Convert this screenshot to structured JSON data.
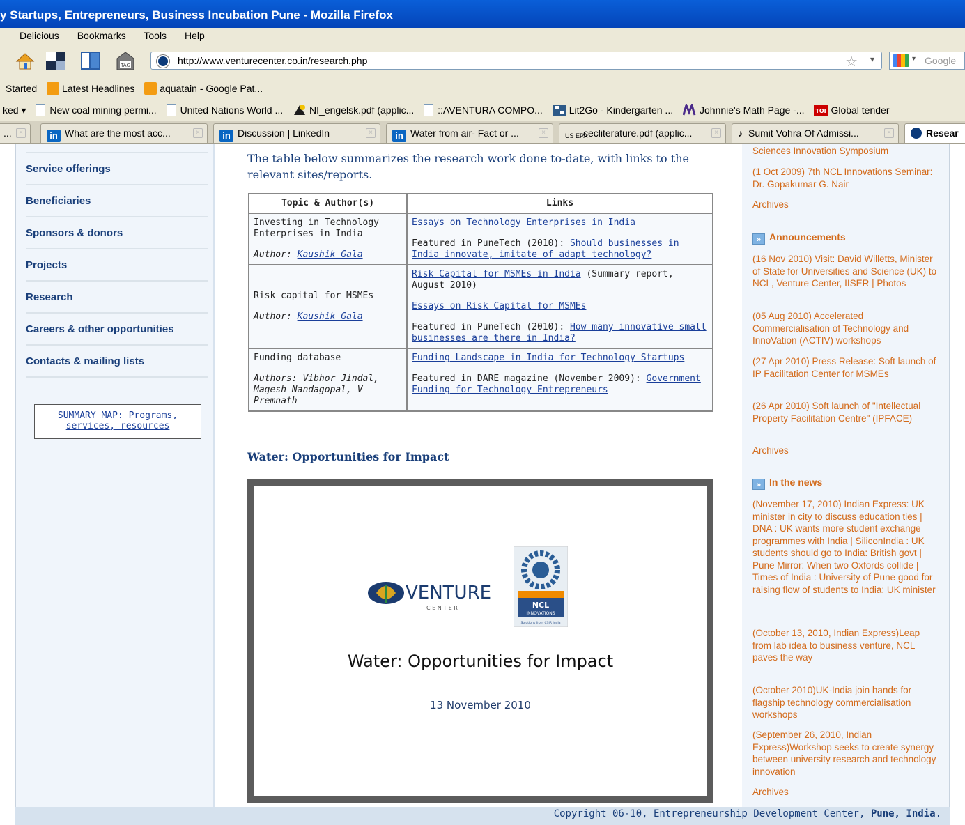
{
  "window": {
    "title": "y Startups, Entrepreneurs, Business Incubation Pune - Mozilla Firefox"
  },
  "menu": {
    "items": [
      "Delicious",
      "Bookmarks",
      "Tools",
      "Help"
    ]
  },
  "navbar": {
    "url": "http://www.venturecenter.co.in/research.php",
    "search_placeholder": "Google"
  },
  "bookmarks_row1": {
    "items": [
      "Started",
      "Latest Headlines",
      "aquatain - Google Pat..."
    ]
  },
  "bookmarks_row2": {
    "items": [
      "ked ▾",
      "New coal mining permi...",
      "United Nations World ...",
      "NI_engelsk.pdf (applic...",
      "::AVENTURA COMPO...",
      "Lit2Go - Kindergarten ...",
      "Johnnie's Math Page -...",
      "Global tender"
    ]
  },
  "tabs": [
    {
      "label": "...",
      "icon": "close-icon"
    },
    {
      "label": "What are the most acc...",
      "icon": "linkedin-icon"
    },
    {
      "label": "Discussion | LinkedIn",
      "icon": "linkedin-icon"
    },
    {
      "label": "Water from air- Fact or ...",
      "icon": "linkedin-icon"
    },
    {
      "label": "cecliterature.pdf (applic...",
      "icon": "usepa-icon",
      "icon_text": "US EPA"
    },
    {
      "label": "Sumit Vohra Of Admissi...",
      "icon": "music-note-icon"
    },
    {
      "label": "Resear",
      "icon": "venture-center-icon"
    }
  ],
  "left_nav": {
    "items": [
      "Service offerings",
      "Beneficiaries",
      "Sponsors & donors",
      "Projects",
      "Research",
      "Careers & other opportunities",
      "Contacts & mailing lists"
    ],
    "summary_map": "SUMMARY MAP: Programs, services, resources"
  },
  "main": {
    "intro": "The table below summarizes the research work done to-date, with links to the relevant sites/reports.",
    "table": {
      "headers": [
        "Topic & Author(s)",
        "Links"
      ],
      "rows": [
        {
          "topic": "Investing in Technology Enterprises in India",
          "author_prefix": "Author: ",
          "author": "Kaushik Gala",
          "link1": "Essays on Technology Enterprises in India",
          "featured_prefix": "Featured in PuneTech (2010): ",
          "featured_link": "Should businesses in India innovate, imitate of adapt technology?"
        },
        {
          "topic": "Risk capital for MSMEs",
          "author_prefix": "Author: ",
          "author": "Kaushik Gala",
          "link1": "Risk Capital for MSMEs in India",
          "link1_suffix": " (Summary report, August 2010)",
          "link2": "Essays on Risk Capital for MSMEs",
          "featured_prefix": "Featured in PuneTech (2010): ",
          "featured_link": "How many innovative small businesses are there in India?"
        },
        {
          "topic": "Funding database",
          "authors": "Authors: Vibhor Jindal, Magesh Nandagopal, V Premnath",
          "link1": "Funding Landscape in India for Technology Startups",
          "featured_prefix": "Featured in DARE magazine (November 2009): ",
          "featured_link": "Government Funding for Technology Entrepreneurs"
        }
      ]
    },
    "section_title": "Water: Opportunities for Impact",
    "slide": {
      "logo_text": "VENTURE",
      "logo_subtext": "C E N T E R",
      "ncl_text": "NCL",
      "ncl_subtext": "INNOVATIONS",
      "ncl_tagline": "Solutions from CSIR India",
      "title": "Water: Opportunities for Impact",
      "date": "13 November 2010"
    }
  },
  "right": {
    "top_items": [
      "Sciences Innovation Symposium",
      "(1 Oct 2009) 7th NCL Innovations Seminar: Dr. Gopakumar G. Nair"
    ],
    "archives_label": "Archives",
    "announcements_title": "Announcements",
    "announcements": [
      "(16 Nov 2010) Visit: David Willetts, Minister of State for Universities and Science (UK) to NCL, Venture Center, IISER | Photos",
      "(05 Aug 2010) Accelerated Commercialisation of Technology and InnoVation (ACTIV) workshops",
      "(27 Apr 2010) Press Release: Soft launch of IP Facilitation Center for MSMEs",
      "(26 Apr 2010) Soft launch of \"Intellectual Property Facilitation Centre\" (IPFACE)"
    ],
    "news_title": "In the news",
    "news": [
      "(November 17, 2010) Indian Express: UK minister in city to discuss education ties | DNA : UK wants more student exchange programmes with India | SiliconIndia : UK students should go to India: British govt | Pune Mirror: When two Oxfords collide | Times of India : University of Pune good for raising flow of students to India: UK minister",
      "(October 13, 2010, Indian Express)Leap from lab idea to business venture, NCL paves the way",
      "(October 2010)UK-India join hands for flagship technology commercialisation workshops",
      "(September 26, 2010, Indian Express)Workshop seeks to create synergy between university research and technology innovation"
    ]
  },
  "footer": {
    "prefix": "Copyright 06-10, Entrepreneurship Development Center, ",
    "bold": "Pune, India",
    "suffix": "."
  },
  "colors": {
    "nav_text": "#1a3f7a",
    "sidebar_text": "#d36a1a",
    "link": "#1a3f9a",
    "title_bar": "#0a5fd8"
  }
}
